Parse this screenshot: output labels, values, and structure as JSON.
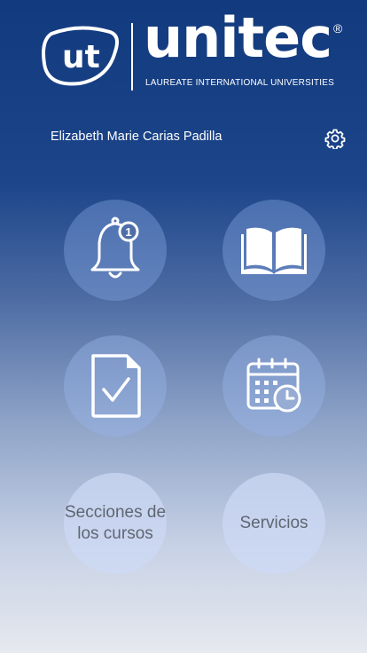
{
  "brand": {
    "mark_text": "ut",
    "wordmark": "unitec",
    "tagline": "LAUREATE INTERNATIONAL UNIVERSITIES",
    "registered": "®"
  },
  "user": {
    "name": "Elizabeth Marie Carias Padilla"
  },
  "icons": {
    "settings": "gear-icon",
    "notifications": "bell-icon",
    "notification_count": "1",
    "courses": "open-book-icon",
    "tasks": "document-check-icon",
    "calendar": "calendar-clock-icon"
  },
  "menu": {
    "sections_label": "Secciones de los cursos",
    "services_label": "Servicios"
  }
}
